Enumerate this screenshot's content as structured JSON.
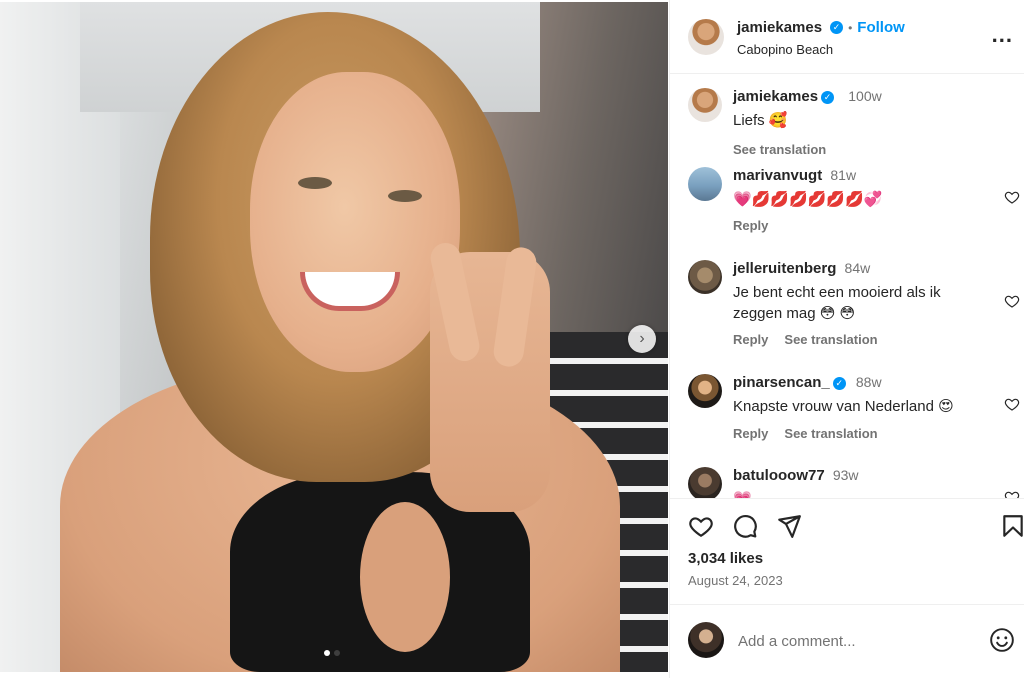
{
  "post": {
    "photo_alt": "Selfie photo",
    "next_icon": "chevron-right-icon",
    "carousel_pages": 2,
    "carousel_active": 1
  },
  "header": {
    "username": "jamiekames",
    "separator": "•",
    "follow_label": "Follow",
    "location": "Cabopino Beach",
    "more_icon": "more-options-icon",
    "more_label": "..."
  },
  "caption": {
    "username": "jamiekames",
    "time": "100w",
    "text": "Liefs 🥰",
    "see_translation": "See translation"
  },
  "comments": [
    {
      "username": "marivanvugt",
      "time": "81w",
      "text": "💗💋💋💋💋💋💋💞",
      "reply": "Reply",
      "translate": ""
    },
    {
      "username": "jelleruitenberg",
      "time": "84w",
      "text": "Je bent echt een mooierd als ik zeggen mag 😳 😳",
      "reply": "Reply",
      "translate": "See translation"
    },
    {
      "username": "pinarsencan_",
      "time": "88w",
      "text": "Knapste vrouw van Nederland 😍",
      "reply": "Reply",
      "translate": "See translation"
    },
    {
      "username": "batulooow77",
      "time": "93w",
      "text": "💗",
      "reply": "",
      "translate": ""
    }
  ],
  "actions": {
    "like_icon": "heart-icon",
    "comment_icon": "comment-icon",
    "share_icon": "share-icon",
    "save_icon": "bookmark-icon"
  },
  "stats": {
    "likes": "3,034 likes",
    "date": "August 24, 2023"
  },
  "composer": {
    "placeholder": "Add a comment...",
    "emoji_icon": "emoji-icon"
  },
  "colors": {
    "accent": "#0095f6",
    "secondary_text": "#737373",
    "border": "#efefef"
  }
}
